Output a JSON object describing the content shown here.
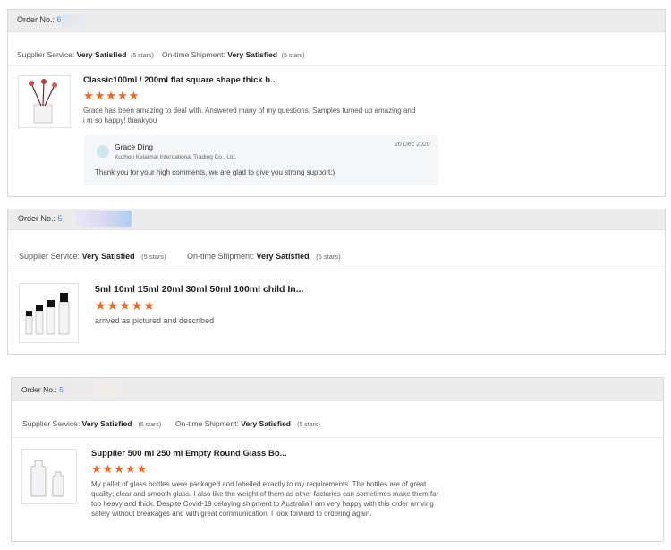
{
  "reviews": [
    {
      "order_label": "Order No.:",
      "order_number": "6",
      "supplier_service": {
        "label": "Supplier Service:",
        "value": "Very Satisfied",
        "stars": "(5 stars)"
      },
      "on_time_shipment": {
        "label": "On-time Shipment:",
        "value": "Very Satisfied",
        "stars": "(5 stars)"
      },
      "product_title": "Classic100ml / 200ml flat square shape thick b...",
      "rating": 5,
      "rating_stars": "★★★★★",
      "review_text": "Grace has been amazing to deal with. Answered many of my questions. Samples turned up amazing and i m so happy! thankyou",
      "reply": {
        "name": "Grace Ding",
        "company": "Xuzhou Kelaimai International Trading Co., Ltd.",
        "date": "20 Dec 2020",
        "text": "Thank you for your high comments, we are glad to give you strong support:)"
      }
    },
    {
      "order_label": "Order No.:",
      "order_number": "5",
      "supplier_service": {
        "label": "Supplier Service:",
        "value": "Very Satisfied",
        "stars": "(5 stars)"
      },
      "on_time_shipment": {
        "label": "On-time Shipment:",
        "value": "Very Satisfied",
        "stars": "(5 stars)"
      },
      "product_title": "5ml 10ml 15ml 20ml 30ml 50ml 100ml child In...",
      "rating": 5,
      "rating_stars": "★★★★★",
      "review_text": "arrived as pictured and described"
    },
    {
      "order_label": "Order No.:",
      "order_number": "5",
      "supplier_service": {
        "label": "Supplier Service:",
        "value": "Very Satisfied",
        "stars": "(5 stars)"
      },
      "on_time_shipment": {
        "label": "On-time Shipment:",
        "value": "Very Satisfied",
        "stars": "(5 stars)"
      },
      "product_title": "Supplier 500 ml 250 ml Empty Round Glass Bo...",
      "rating": 5,
      "rating_stars": "★★★★★",
      "review_text": "My pallet of glass bottles were packaged and labelled exactly to my requirements. The bottles are of great quality; clear and smooth glass. I also like the weight of them as other factories can sometimes make them far too heavy and thick.  Despite Covid-19 delaying shipment to Australia I am very happy with this order arriving safely without breakages and with great communication. I look forward to ordering again."
    }
  ],
  "colors": {
    "star": "#f3661b",
    "order_number": "#4a8fd6",
    "order_bar": "#ececec"
  }
}
